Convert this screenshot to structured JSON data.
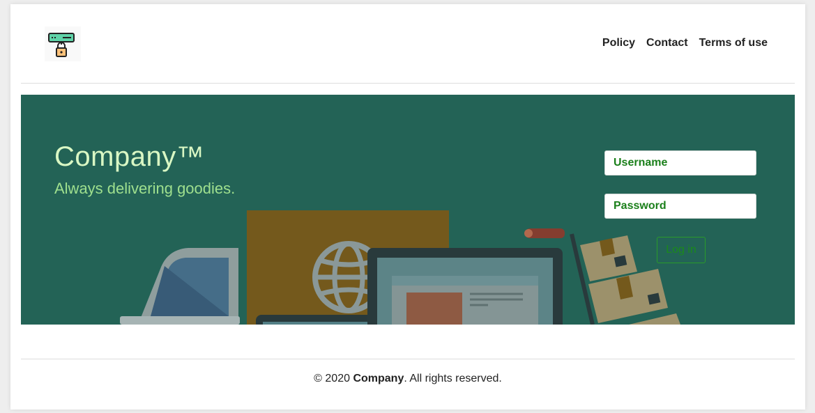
{
  "header": {
    "logo_icon": "server-lock-icon",
    "nav": [
      {
        "label": "Policy"
      },
      {
        "label": "Contact"
      },
      {
        "label": "Terms of use"
      }
    ]
  },
  "hero": {
    "title": "Company™",
    "subtitle": "Always delivering goodies.",
    "background_color": "#246356",
    "illustration_icons": [
      "laptop-illustration",
      "globe-box-illustration",
      "monitor-illustration",
      "hand-truck-illustration",
      "parcel-illustration"
    ]
  },
  "login": {
    "username_placeholder": "Username",
    "password_placeholder": "Password",
    "button_label": "Log in"
  },
  "footer": {
    "prefix": "© 2020 ",
    "company": "Company",
    "suffix": ". All rights reserved."
  }
}
